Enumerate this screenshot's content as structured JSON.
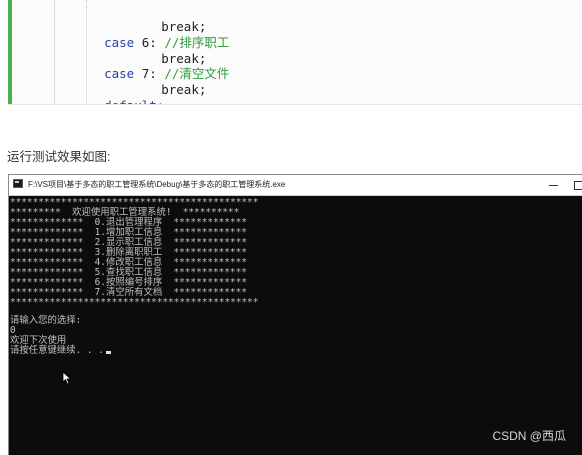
{
  "code": {
    "lines": [
      {
        "kw": "",
        "plain": "    break;",
        "cm": ""
      },
      {
        "kw": "case",
        "plain": " 6: ",
        "cm": "//排序职工"
      },
      {
        "kw": "",
        "plain": "    break;",
        "cm": ""
      },
      {
        "kw": "case",
        "plain": " 7: ",
        "cm": "//清空文件"
      },
      {
        "kw": "",
        "plain": "    break;",
        "cm": ""
      },
      {
        "kw": "default",
        "plain": ":",
        "cm": ""
      }
    ]
  },
  "caption": "运行测试效果如图:",
  "window": {
    "title": "F:\\VS项目\\基于多态的职工管理系统\\Debug\\基于多态的职工管理系统.exe",
    "buttons": [
      "minimize",
      "maximize"
    ]
  },
  "console": {
    "lines": [
      "********************************************",
      "*********  欢迎使用职工管理系统!  **********",
      "*************  0.退出管理程序  *************",
      "*************  1.增加职工信息  *************",
      "*************  2.显示职工信息  *************",
      "*************  3.删除离职职工  *************",
      "*************  4.修改职工信息  *************",
      "*************  5.查找职工信息  *************",
      "*************  6.按照编号排序  *************",
      "*************  7.清空所有文档  *************",
      "********************************************",
      "",
      "请输入您的选择:",
      "0",
      "欢迎下次使用",
      "请按任意键继续. . ."
    ]
  },
  "watermark": "CSDN @西瓜",
  "icons": {
    "app": "console-app-icon",
    "cursor": "mouse-pointer-icon"
  }
}
